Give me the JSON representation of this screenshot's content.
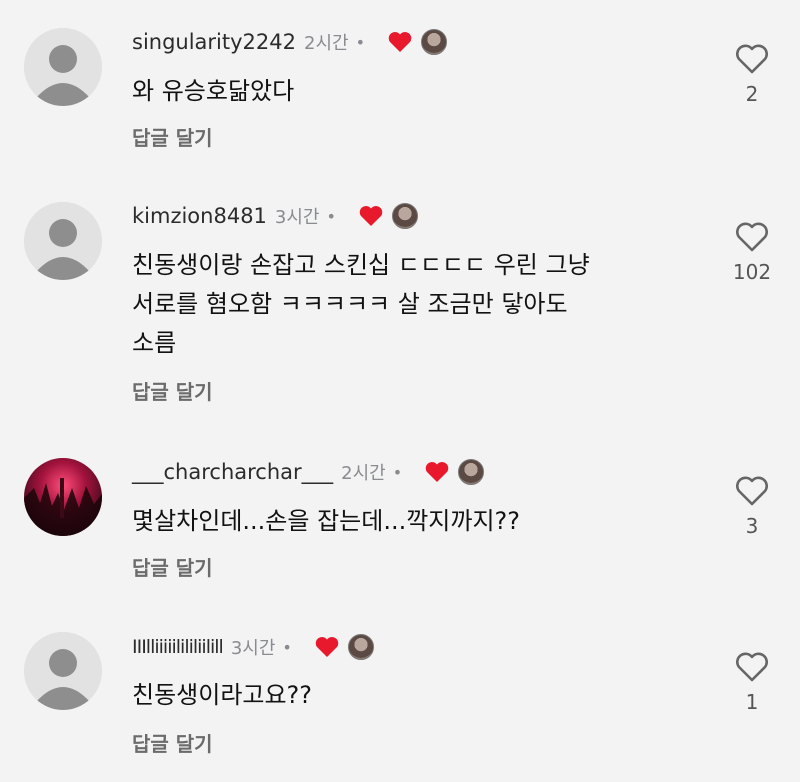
{
  "reply_label": "답글 달기",
  "colors": {
    "heart": "#e8192c",
    "background": "#f3f3f3",
    "meta": "#8a8b91"
  },
  "comments": [
    {
      "username": "singularity2242",
      "time": "2시간",
      "dot": "•",
      "text": "와 유승호닮았다",
      "likes": "2",
      "avatar": "default-avatar",
      "creator_liked": true
    },
    {
      "username": "kimzion8481",
      "time": "3시간",
      "dot": "•",
      "text": "친동생이랑 손잡고 스킨십 ㄷㄷㄷㄷ 우린 그냥\n서로를 혐오함 ㅋㅋㅋㅋㅋ 살 조금만 닿아도\n소름",
      "likes": "102",
      "avatar": "default-avatar",
      "creator_liked": true
    },
    {
      "username": "___charcharchar___",
      "time": "2시간",
      "dot": "•",
      "text": "몇살차인데...손을 잡는데...깍지까지??",
      "likes": "3",
      "avatar": "dark-red-photo-avatar",
      "creator_liked": true
    },
    {
      "username": "IIIlliiiiilililiilill",
      "time": "3시간",
      "dot": "•",
      "text": "친동생이라고요??",
      "likes": "1",
      "avatar": "default-avatar",
      "creator_liked": true
    }
  ]
}
